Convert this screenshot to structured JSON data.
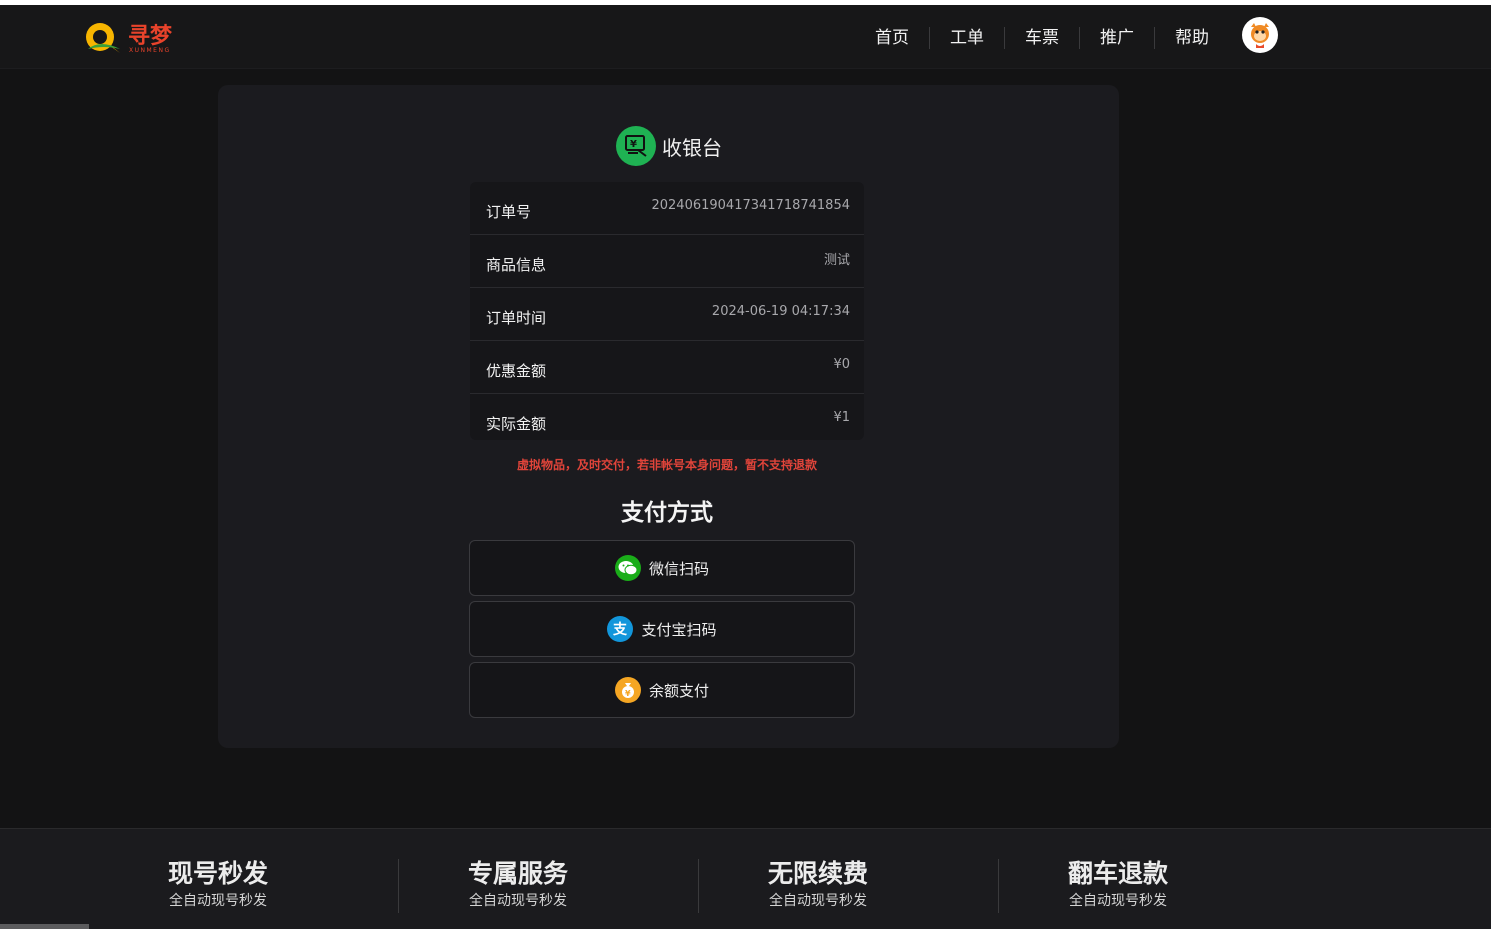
{
  "header": {
    "logo_text": "寻梦",
    "logo_subtext": "XUNMENG",
    "nav": [
      {
        "label": "首页"
      },
      {
        "label": "工单"
      },
      {
        "label": "车票"
      },
      {
        "label": "推广"
      },
      {
        "label": "帮助"
      }
    ],
    "avatar_icon": "cartoon-avatar-icon"
  },
  "cashier": {
    "title": "收银台",
    "icon": "cashier-yen-icon",
    "accent": "#1fb253"
  },
  "order": {
    "rows": [
      {
        "label": "订单号",
        "value": "20240619041734171874185 4"
      },
      {
        "label": "商品信息",
        "value": "测试"
      },
      {
        "label": "订单时间",
        "value": "2024-06-19 04:17:34"
      },
      {
        "label": "优惠金额",
        "value": "¥0"
      },
      {
        "label": "实际金额",
        "value": "¥1"
      }
    ]
  },
  "notice": "虚拟物品，及时交付，若非帐号本身问题，暂不支持退款",
  "payment": {
    "title": "支付方式",
    "methods": [
      {
        "label": "微信扫码",
        "icon": "wechat-icon",
        "color": "#1aad19"
      },
      {
        "label": "支付宝扫码",
        "icon": "alipay-icon",
        "color": "#1677ff"
      },
      {
        "label": "余额支付",
        "icon": "wallet-coin-icon",
        "color": "#f5a623"
      }
    ]
  },
  "footer": {
    "features": [
      {
        "title": "现号秒发",
        "subtitle": "全自动现号秒发"
      },
      {
        "title": "专属服务",
        "subtitle": "全自动现号秒发"
      },
      {
        "title": "无限续费",
        "subtitle": "全自动现号秒发"
      },
      {
        "title": "翻车退款",
        "subtitle": "全自动现号秒发"
      }
    ]
  }
}
